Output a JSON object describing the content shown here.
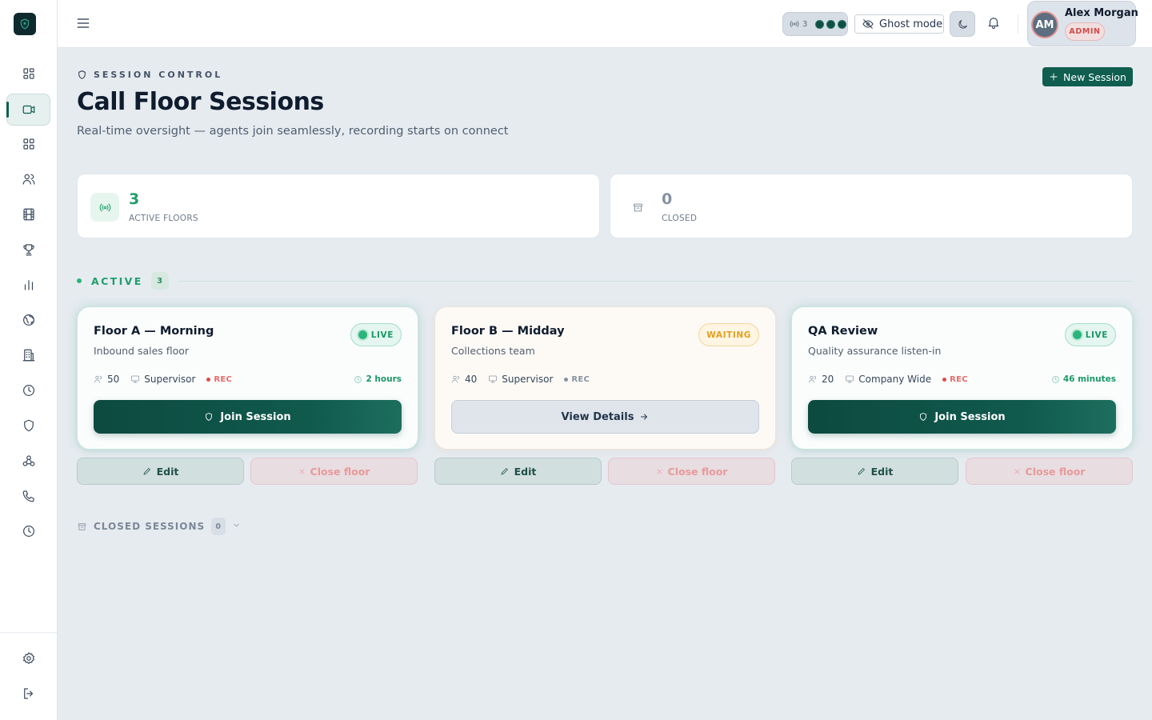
{
  "topbar": {
    "live_count": "3",
    "ghost_label": "Ghost mode",
    "user_name": "Alex Morgan",
    "user_role": "ADMIN",
    "user_initials": "AM"
  },
  "header": {
    "eyebrow": "SESSION CONTROL",
    "title": "Call Floor Sessions",
    "subtitle": "Real-time oversight — agents join seamlessly, recording starts on connect",
    "new_session_label": "New Session"
  },
  "stats": {
    "active": {
      "value": "3",
      "label": "ACTIVE FLOORS"
    },
    "closed": {
      "value": "0",
      "label": "CLOSED"
    }
  },
  "active_section": {
    "label": "ACTIVE",
    "count": "3"
  },
  "sessions": [
    {
      "title": "Floor A — Morning",
      "subtitle": "Inbound sales floor",
      "status": "LIVE",
      "agents": "50",
      "scope": "Supervisor",
      "rec": "REC",
      "duration": "2 hours",
      "action": "Join Session",
      "edit": "Edit",
      "close": "Close floor"
    },
    {
      "title": "Floor B — Midday",
      "subtitle": "Collections team",
      "status": "WAITING",
      "agents": "40",
      "scope": "Supervisor",
      "rec": "REC",
      "duration": "",
      "action": "View Details",
      "edit": "Edit",
      "close": "Close floor"
    },
    {
      "title": "QA Review",
      "subtitle": "Quality assurance listen-in",
      "status": "LIVE",
      "agents": "20",
      "scope": "Company Wide",
      "rec": "REC",
      "duration": "46 minutes",
      "action": "Join Session",
      "edit": "Edit",
      "close": "Close floor"
    }
  ],
  "closed_section": {
    "label": "CLOSED SESSIONS",
    "count": "0"
  },
  "colors": {
    "brand": "#0f5e50",
    "live": "#1a9866",
    "waiting": "#e2a01f",
    "rec": "#e54848",
    "admin": "#d14b4b"
  },
  "icons": {
    "sidebar": [
      "dashboard-icon",
      "video-icon",
      "grid-icon",
      "users-icon",
      "film-icon",
      "trophy-icon",
      "bar-chart-icon",
      "globe-icon",
      "building-icon",
      "clock-icon",
      "shield-icon",
      "webhook-icon",
      "phone-icon",
      "history-icon",
      "settings-icon",
      "logout-icon"
    ]
  }
}
